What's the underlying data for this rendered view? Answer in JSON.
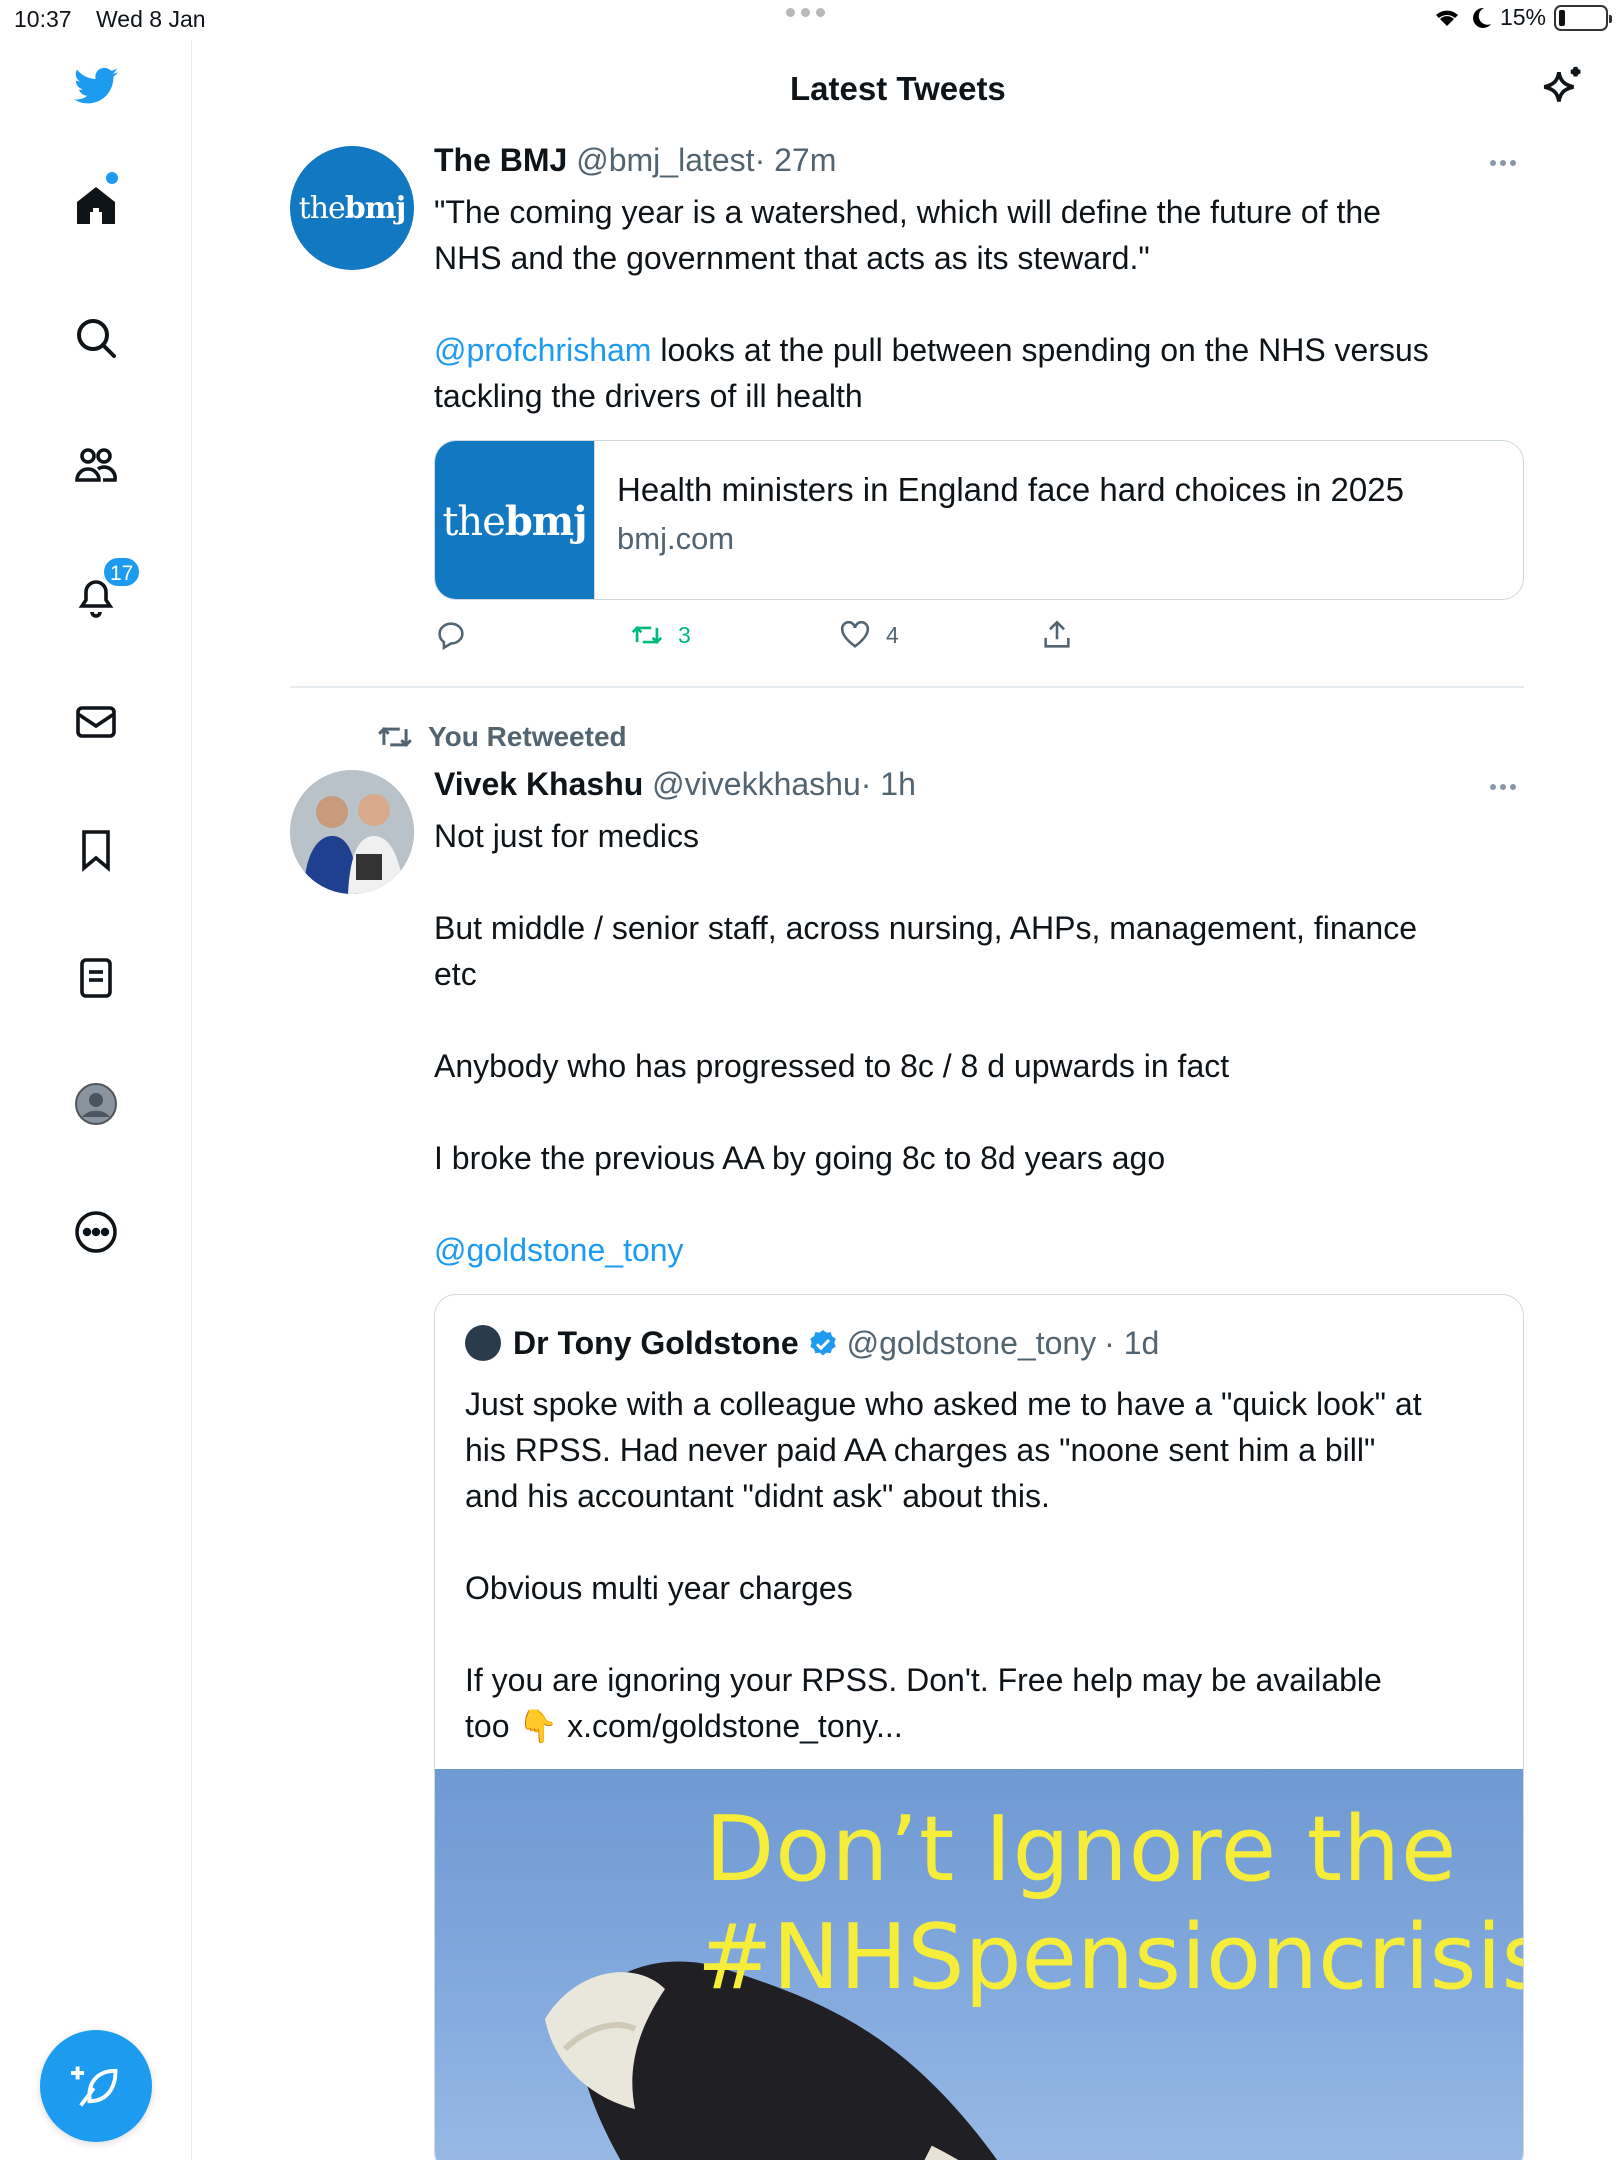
{
  "status_bar": {
    "time": "10:37",
    "date": "Wed 8 Jan",
    "battery": "15%"
  },
  "header": {
    "title": "Latest Tweets"
  },
  "sidebar": {
    "notification_count": "17"
  },
  "tweet1": {
    "author": "The BMJ",
    "handle": "@bmj_latest",
    "time": "· 27m",
    "avatar_text_light": "the",
    "avatar_text_bold": "bmj",
    "line1": "\"The coming year is a watershed, which will define the future of the",
    "line2": "NHS and the government that acts as its steward.\"",
    "mention": "@profchrisham",
    "line3": " looks at the pull between spending on the NHS versus",
    "line4": "tackling the drivers of ill health",
    "card": {
      "title": "Health ministers in England face hard choices in 2025",
      "domain": "bmj.com"
    },
    "stats": {
      "retweets": "3",
      "likes": "4"
    }
  },
  "tweet2": {
    "retweet_label": "You Retweeted",
    "author": "Vivek Khashu",
    "handle": "@vivekkhashu",
    "time": "· 1h",
    "p1": "Not just for medics",
    "p2a": "But middle / senior staff, across nursing, AHPs, management, finance",
    "p2b": "etc",
    "p3": "Anybody who has progressed to 8c / 8 d upwards in fact",
    "p4": "I broke the previous AA by going 8c to 8d years ago",
    "mention": "@goldstone_tony",
    "quote": {
      "author": "Dr Tony Goldstone",
      "handle": "@goldstone_tony",
      "time": "· 1d",
      "l1": "Just spoke with a colleague who asked me to have a \"quick look\" at",
      "l2": "his RPSS. Had never paid AA charges as \"noone sent him a bill\"",
      "l3": "and his accountant \"didnt ask\" about this.",
      "l4": "Obvious multi year charges",
      "l5": "If you are ignoring your RPSS. Don't.  Free help may be available",
      "l6_prefix": "too ",
      "l6_emoji": "👇",
      "l6_link": " x.com/goldstone_tony...",
      "image_line1": "Don’t Ignore the",
      "image_line2": "#NHSpensioncrisis"
    }
  },
  "colors": {
    "accent": "#1d9bf0",
    "retweet_green": "#00ba7c",
    "secondary_text": "#536471",
    "bmj_blue": "#1278c2"
  }
}
